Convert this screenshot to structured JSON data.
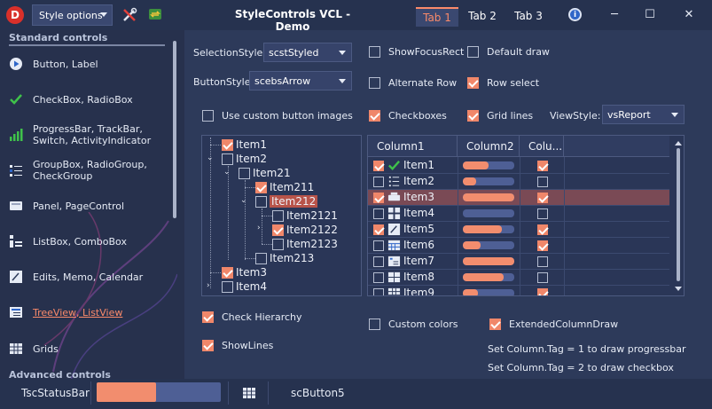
{
  "titlebar": {
    "style_options_label": "Style options",
    "title": "StyleControls VCL - Demo",
    "tabs": [
      "Tab 1",
      "Tab 2",
      "Tab 3"
    ],
    "active_tab": 0,
    "minimize": "─",
    "maximize": "☐",
    "close": "✕",
    "info_glyph": "i"
  },
  "sidebar": {
    "standard_header": "Standard controls",
    "advanced_header": "Advanced controls",
    "items": [
      {
        "label": "Button, Label",
        "icon": "play-button-icon"
      },
      {
        "label": "CheckBox, RadioBox",
        "icon": "checkmark-icon"
      },
      {
        "label": "ProgressBar, TrackBar, Switch, ActivityIndicator",
        "icon": "bar-chart-icon"
      },
      {
        "label": "GroupBox, RadioGroup, CheckGroup",
        "icon": "group-list-icon"
      },
      {
        "label": "Panel, PageControl",
        "icon": "panel-icon"
      },
      {
        "label": "ListBox, ComboBox",
        "icon": "listbox-icon"
      },
      {
        "label": "Edits, Memo, Calendar",
        "icon": "edit-pen-icon"
      },
      {
        "label": "TreeView, ListView",
        "icon": "treeview-icon"
      },
      {
        "label": "Grids",
        "icon": "grid-icon"
      }
    ],
    "selected_index": 7
  },
  "options": {
    "selection_style_label": "SelectionStyle:",
    "selection_style_value": "scstStyled",
    "button_style_label": "ButtonStyle:",
    "button_style_value": "scebsArrow",
    "view_style_label": "ViewStyle:",
    "view_style_value": "vsReport",
    "checks": {
      "show_focus_rect": {
        "label": "ShowFocusRect",
        "checked": false
      },
      "default_draw": {
        "label": "Default draw",
        "checked": false
      },
      "alternate_row": {
        "label": "Alternate Row",
        "checked": false
      },
      "row_select": {
        "label": "Row select",
        "checked": true
      },
      "custom_button_images": {
        "label": "Use custom button images",
        "checked": false
      },
      "checkboxes": {
        "label": "Checkboxes",
        "checked": true
      },
      "grid_lines": {
        "label": "Grid lines",
        "checked": true
      },
      "check_hierarchy": {
        "label": "Check Hierarchy",
        "checked": true
      },
      "show_lines": {
        "label": "ShowLines",
        "checked": true
      },
      "custom_colors": {
        "label": "Custom colors",
        "checked": false
      },
      "extended_column_draw": {
        "label": "ExtendedColumnDraw",
        "checked": true
      }
    },
    "hint1": "Set Column.Tag = 1 to draw progressbar",
    "hint2": "Set Column.Tag = 2 to draw checkbox"
  },
  "tree": {
    "nodes": [
      {
        "label": "Item1",
        "checked": true
      },
      {
        "label": "Item2",
        "checked": false
      },
      {
        "label": "Item21",
        "checked": false
      },
      {
        "label": "Item211",
        "checked": true
      },
      {
        "label": "Item212",
        "checked": false
      },
      {
        "label": "Item2121",
        "checked": false
      },
      {
        "label": "Item2122",
        "checked": true
      },
      {
        "label": "Item2123",
        "checked": false
      },
      {
        "label": "Item213",
        "checked": false
      },
      {
        "label": "Item3",
        "checked": true
      },
      {
        "label": "Item4",
        "checked": false
      }
    ]
  },
  "list": {
    "columns": [
      "Column1",
      "Column2",
      "Colu..."
    ],
    "rows": [
      {
        "name": "Item1",
        "checked": true,
        "progress": 0.5,
        "check2": true,
        "icon": "green-check-icon"
      },
      {
        "name": "Item2",
        "checked": false,
        "progress": 0.25,
        "check2": false,
        "icon": "list-icon"
      },
      {
        "name": "Item3",
        "checked": true,
        "progress": 1.0,
        "check2": true,
        "icon": "printer-icon"
      },
      {
        "name": "Item4",
        "checked": false,
        "progress": 0.0,
        "check2": false,
        "icon": "component-icon"
      },
      {
        "name": "Item5",
        "checked": true,
        "progress": 0.75,
        "check2": true,
        "icon": "pen-icon"
      },
      {
        "name": "Item6",
        "checked": false,
        "progress": 0.35,
        "check2": true,
        "icon": "calendar-icon"
      },
      {
        "name": "Item7",
        "checked": false,
        "progress": 1.0,
        "check2": false,
        "icon": "treelist-icon"
      },
      {
        "name": "Item8",
        "checked": false,
        "progress": 0.8,
        "check2": false,
        "icon": "table-icon"
      },
      {
        "name": "Item9",
        "checked": false,
        "progress": 0.3,
        "check2": true,
        "icon": "grid-icon"
      }
    ],
    "selected_index": 2
  },
  "statusbar": {
    "label": "TscStatusBar",
    "progress": 0.48,
    "button_label": "scButton5",
    "icon": "calculator-icon"
  },
  "colors": {
    "accent": "#f0876a",
    "background": "#2d3a5a",
    "sidebar": "#27314d",
    "selection": "#b8544a"
  }
}
